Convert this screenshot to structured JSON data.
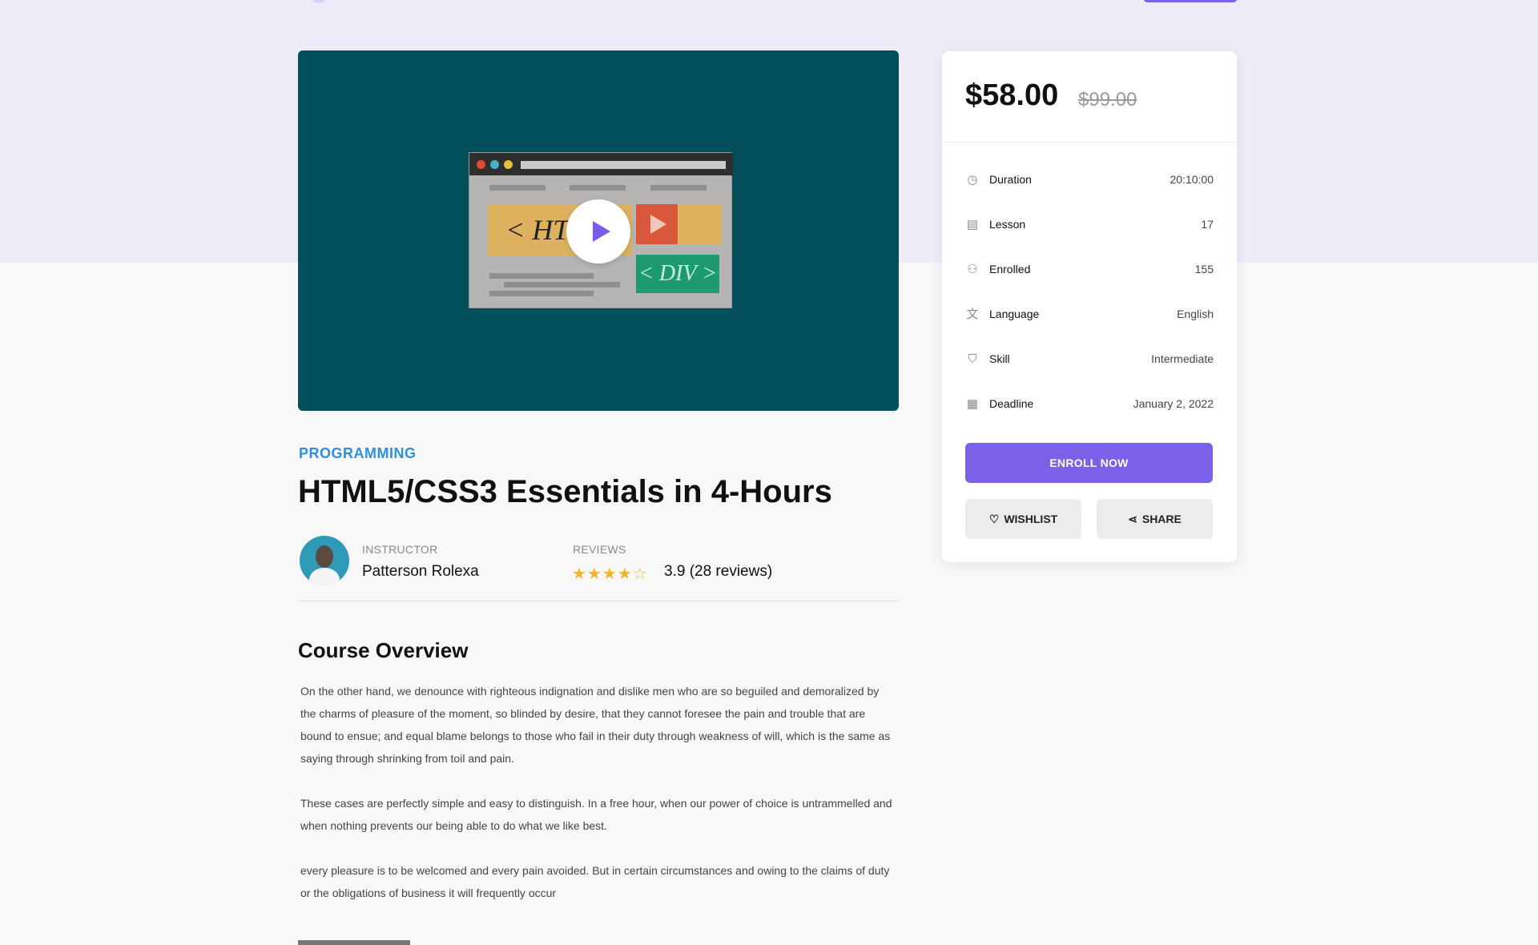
{
  "course": {
    "category": "PROGRAMMING",
    "title": "HTML5/CSS3 Essentials in 4-Hours",
    "video_thumb": {
      "html_text": "< HTML",
      "div_text": "< DIV >"
    },
    "instructor_label": "INSTRUCTOR",
    "instructor_name": "Patterson Rolexa",
    "reviews_label": "REVIEWS",
    "rating": 3.9,
    "rating_text": "3.9 (28 reviews)",
    "stars": "★★★★☆"
  },
  "overview": {
    "heading": "Course Overview",
    "paragraphs": [
      "On the other hand, we denounce with righteous indignation and dislike men who are so beguiled and demoralized by the charms of pleasure of the moment, so blinded by desire, that they cannot foresee the pain and trouble that are bound to ensue; and equal blame belongs to those who fail in their duty through weakness of will, which is the same as saying through shrinking from toil and pain.",
      "These cases are perfectly simple and easy to distinguish. In a free hour, when our power of choice is untrammelled and when nothing prevents our being able to do what we like best.",
      "every pleasure is to be welcomed and every pain avoided. But in certain circumstances and owing to the claims of duty or the obligations of business it will frequently occur"
    ]
  },
  "pricing": {
    "price": "$58.00",
    "old_price": "$99.00",
    "rows": [
      {
        "icon": "clock-icon",
        "label": "Duration",
        "value": "20:10:00"
      },
      {
        "icon": "lesson-icon",
        "label": "Lesson",
        "value": "17"
      },
      {
        "icon": "users-icon",
        "label": "Enrolled",
        "value": "155"
      },
      {
        "icon": "language-icon",
        "label": "Language",
        "value": "English"
      },
      {
        "icon": "shield-icon",
        "label": "Skill",
        "value": "Intermediate"
      },
      {
        "icon": "calendar-icon",
        "label": "Deadline",
        "value": "January 2, 2022"
      }
    ],
    "enroll_label": "ENROLL NOW",
    "wishlist_label": "WISHLIST",
    "share_label": "SHARE"
  },
  "colors": {
    "accent": "#7b61e8",
    "category": "#2f8fdc",
    "hero_band": "#efecfa",
    "video_bg": "#034f5c",
    "star": "#f2b22b"
  }
}
